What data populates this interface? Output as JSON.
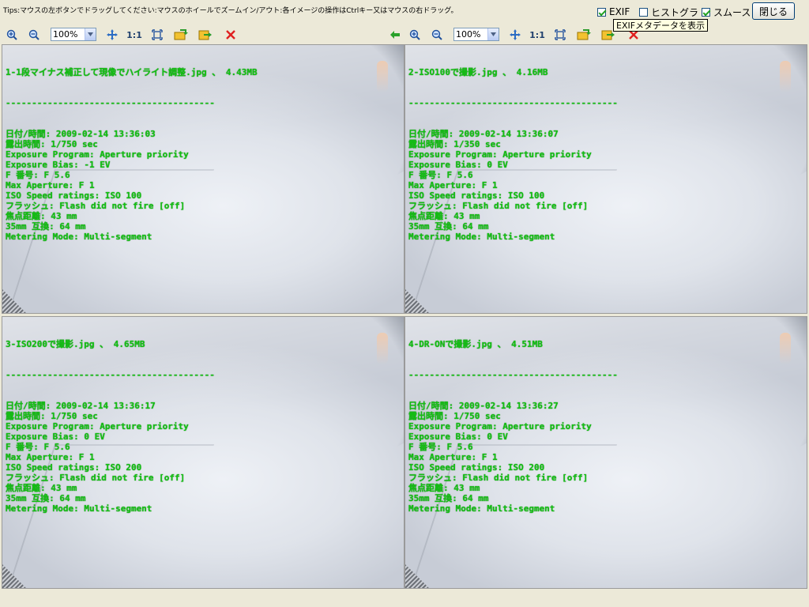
{
  "tips": "Tips:マウスの左ボタンでドラッグしてください:マウスのホイールでズームイン/アウト:各イメージの操作はCtrlキー又はマウスの右ドラッグ。",
  "options": {
    "exif_label": "EXIF",
    "exif_checked": true,
    "histogram_label": "ヒストグラ",
    "histogram_checked": false,
    "smooth_label": "スムース",
    "smooth_checked": true
  },
  "close_label": "閉じる",
  "tooltip": "EXIFメタデータを表示",
  "panels": [
    {
      "zoom": "100%",
      "one_to_one": "1:1",
      "filename": "1-1段マイナス補正して現像でハイライト調整.jpg 、 4.43MB",
      "separator": "----------------------------------------",
      "exif": [
        "日付/時間: 2009-02-14 13:36:03",
        "露出時間: 1/750 sec",
        "Exposure Program: Aperture priority",
        "Exposure Bias: -1 EV",
        "F 番号: F 5.6",
        "Max Aperture: F 1",
        "ISO Speed ratings: ISO 100",
        "フラッシュ: Flash did not fire [off]",
        "焦点距離: 43 mm",
        "35mm 互換: 64 mm",
        "Metering Mode: Multi-segment"
      ]
    },
    {
      "zoom": "100%",
      "one_to_one": "1:1",
      "filename": "2-ISO100で撮影.jpg 、 4.16MB",
      "separator": "----------------------------------------",
      "exif": [
        "日付/時間: 2009-02-14 13:36:07",
        "露出時間: 1/350 sec",
        "Exposure Program: Aperture priority",
        "Exposure Bias: 0 EV",
        "F 番号: F 5.6",
        "Max Aperture: F 1",
        "ISO Speed ratings: ISO 100",
        "フラッシュ: Flash did not fire [off]",
        "焦点距離: 43 mm",
        "35mm 互換: 64 mm",
        "Metering Mode: Multi-segment"
      ]
    },
    {
      "zoom": "100%",
      "one_to_one": "1:1",
      "filename": "3-ISO200で撮影.jpg 、 4.65MB",
      "separator": "----------------------------------------",
      "exif": [
        "日付/時間: 2009-02-14 13:36:17",
        "露出時間: 1/750 sec",
        "Exposure Program: Aperture priority",
        "Exposure Bias: 0 EV",
        "F 番号: F 5.6",
        "Max Aperture: F 1",
        "ISO Speed ratings: ISO 200",
        "フラッシュ: Flash did not fire [off]",
        "焦点距離: 43 mm",
        "35mm 互換: 64 mm",
        "Metering Mode: Multi-segment"
      ]
    },
    {
      "zoom": "100%",
      "one_to_one": "1:1",
      "filename": "4-DR-ONで撮影.jpg 、 4.51MB",
      "separator": "----------------------------------------",
      "exif": [
        "日付/時間: 2009-02-14 13:36:27",
        "露出時間: 1/750 sec",
        "Exposure Program: Aperture priority",
        "Exposure Bias: 0 EV",
        "F 番号: F 5.6",
        "Max Aperture: F 1",
        "ISO Speed ratings: ISO 200",
        "フラッシュ: Flash did not fire [off]",
        "焦点距離: 43 mm",
        "35mm 互換: 64 mm",
        "Metering Mode: Multi-segment"
      ]
    }
  ],
  "colors": {
    "exif_text": "#12c112",
    "close_icon": "#e02020",
    "toolbar_bg": "#ece9d8"
  }
}
